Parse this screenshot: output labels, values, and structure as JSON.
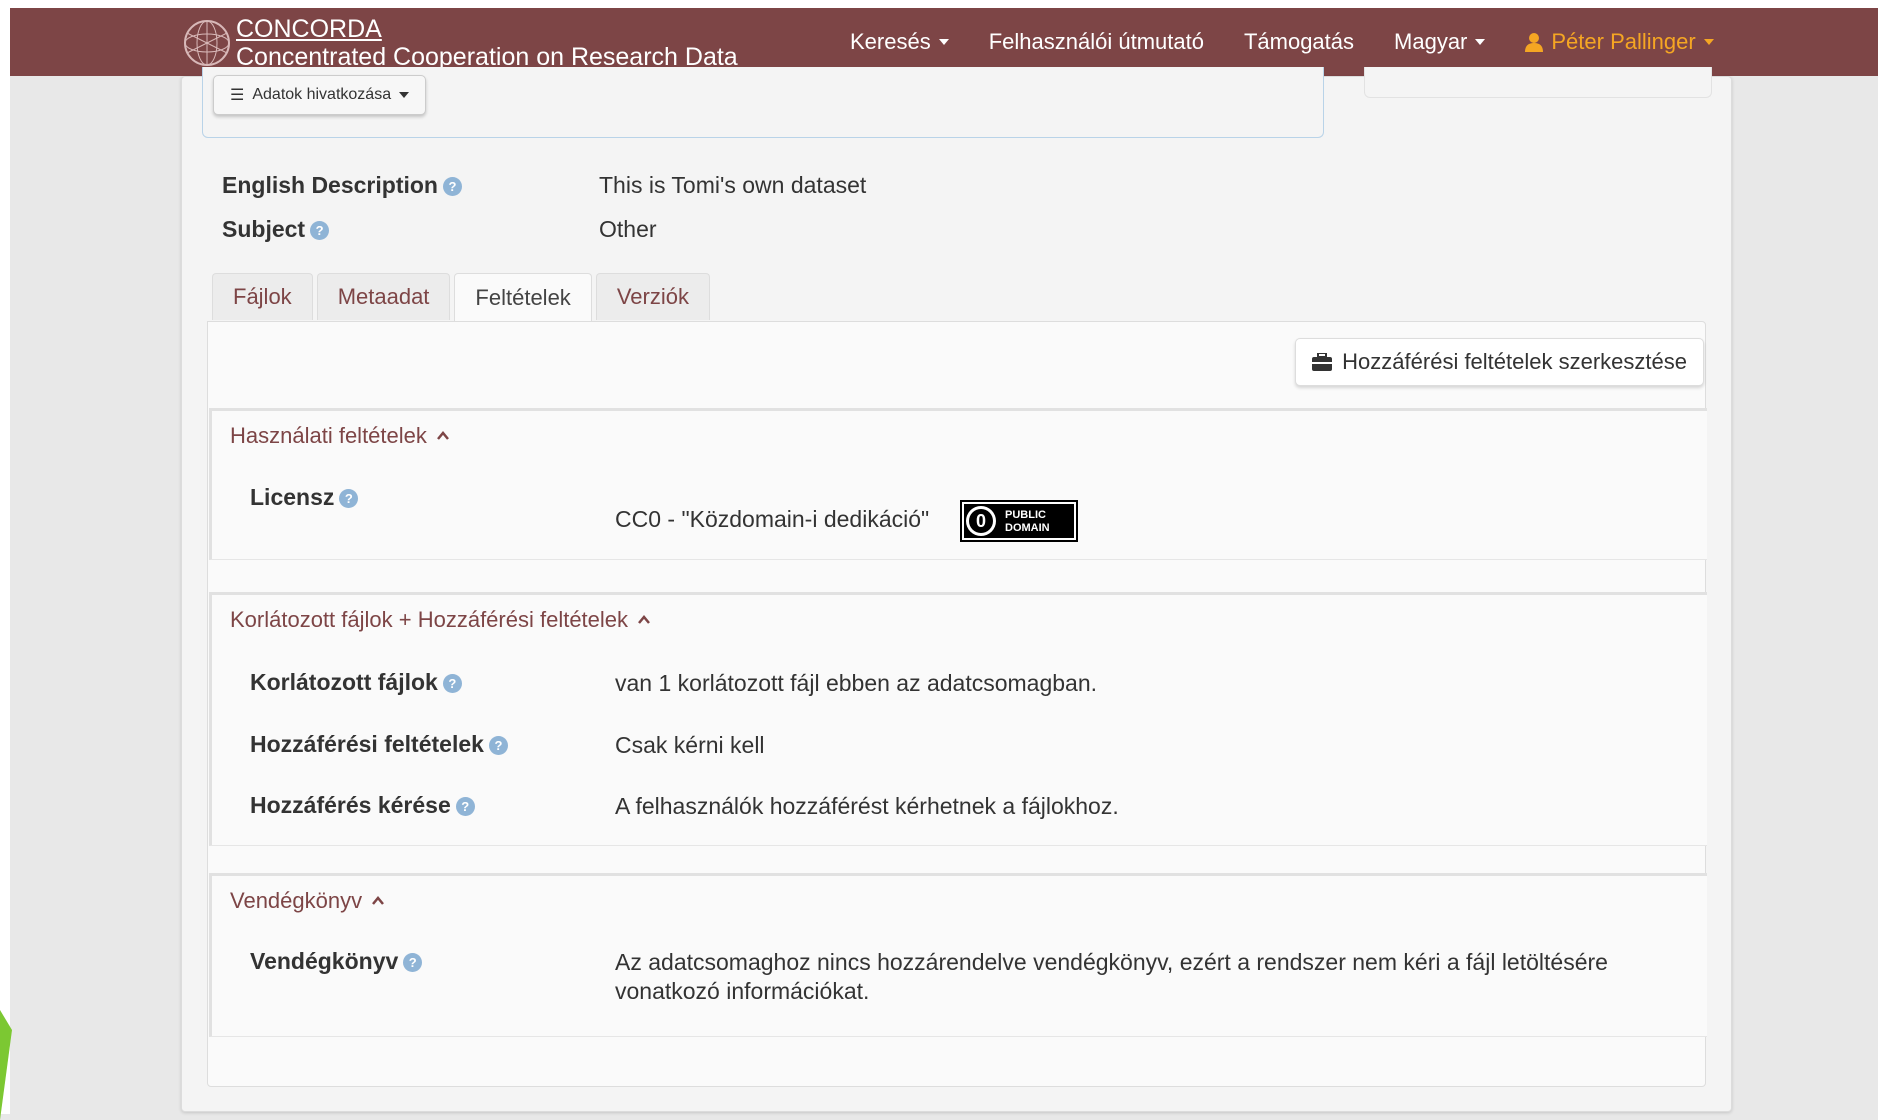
{
  "navbar": {
    "brand_name": "CONCORDA",
    "brand_subtitle": "Concentrated Cooperation on Research Data",
    "items": [
      {
        "label": "Keresés",
        "dropdown": true
      },
      {
        "label": "Felhasználói útmutató",
        "dropdown": false
      },
      {
        "label": "Támogatás",
        "dropdown": false
      },
      {
        "label": "Magyar",
        "dropdown": true
      }
    ],
    "user": {
      "label": "Péter Pallinger",
      "icon": "user-icon",
      "color": "#f5a623"
    },
    "background": "#7d4546"
  },
  "citation": {
    "button_label": "Adatok hivatkozása",
    "icon": "list-icon"
  },
  "metadata": [
    {
      "label": "English Description",
      "value": "This is Tomi's own dataset"
    },
    {
      "label": "Subject",
      "value": "Other"
    }
  ],
  "tabs": [
    {
      "label": "Fájlok",
      "active": false
    },
    {
      "label": "Metaadat",
      "active": false
    },
    {
      "label": "Feltételek",
      "active": true
    },
    {
      "label": "Verziók",
      "active": false
    }
  ],
  "edit_button": {
    "label": "Hozzáférési feltételek szerkesztése",
    "icon": "briefcase-icon"
  },
  "sections": {
    "usage": {
      "title": "Használati feltételek",
      "license_label": "Licensz",
      "license_value": "CC0 - \"Közdomain-i dedikáció\"",
      "badge_line1": "PUBLIC",
      "badge_line2": "DOMAIN",
      "badge_symbol": "0"
    },
    "restricted": {
      "title": "Korlátozott fájlok + Hozzáférési feltételek",
      "rows": [
        {
          "label": "Korlátozott fájlok",
          "value": "van 1 korlátozott fájl ebben az adatcsomagban."
        },
        {
          "label": "Hozzáférési feltételek",
          "value": "Csak kérni kell"
        },
        {
          "label": "Hozzáférés kérése",
          "value": "A felhasználók hozzáférést kérhetnek a fájlokhoz."
        }
      ]
    },
    "guestbook": {
      "title": "Vendégkönyv",
      "label": "Vendégkönyv",
      "value": "Az adatcsomaghoz nincs hozzárendelve vendégkönyv, ezért a rendszer nem kéri a fájl letöltésére vonatkozó információkat."
    }
  },
  "help_symbol": "?",
  "accent_color": "#7d4546"
}
